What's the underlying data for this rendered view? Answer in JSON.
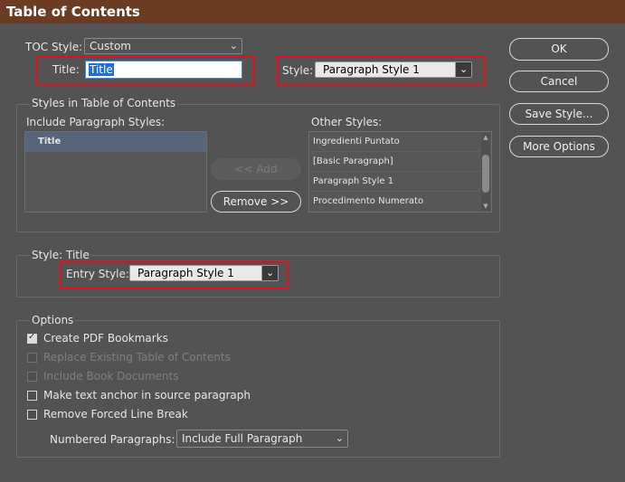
{
  "window": {
    "title": "Table of Contents"
  },
  "toc_style": {
    "label": "TOC Style:",
    "value": "Custom"
  },
  "title_field": {
    "label": "Title:",
    "value": "Title"
  },
  "title_style": {
    "label": "Style:",
    "value": "Paragraph Style 1"
  },
  "styles_group": {
    "title": "Styles in Table of Contents",
    "include_label": "Include Paragraph Styles:",
    "include_items": [
      "Title"
    ],
    "other_label": "Other Styles:",
    "other_items": [
      "Ingredienti Puntato",
      "[Basic Paragraph]",
      "Paragraph Style 1",
      "Procedimento Numerato"
    ],
    "add_button": "<< Add",
    "remove_button": "Remove >>"
  },
  "style_group": {
    "title": "Style: Title",
    "entry_label": "Entry Style:",
    "entry_value": "Paragraph Style 1"
  },
  "options_group": {
    "title": "Options",
    "checkboxes": [
      {
        "label": "Create PDF Bookmarks",
        "checked": true,
        "enabled": true
      },
      {
        "label": "Replace Existing Table of Contents",
        "checked": false,
        "enabled": false
      },
      {
        "label": "Include Book Documents",
        "checked": false,
        "enabled": false
      },
      {
        "label": "Make text anchor in source paragraph",
        "checked": false,
        "enabled": true
      },
      {
        "label": "Remove Forced Line Break",
        "checked": false,
        "enabled": true
      }
    ],
    "numbered_label": "Numbered Paragraphs:",
    "numbered_value": "Include Full Paragraph"
  },
  "buttons": {
    "ok": "OK",
    "cancel": "Cancel",
    "save_style": "Save Style...",
    "more_options": "More Options"
  },
  "colors": {
    "titlebar": "#6b3c22",
    "panel": "#535353",
    "highlight": "#e0101f",
    "selection": "#56657a"
  }
}
